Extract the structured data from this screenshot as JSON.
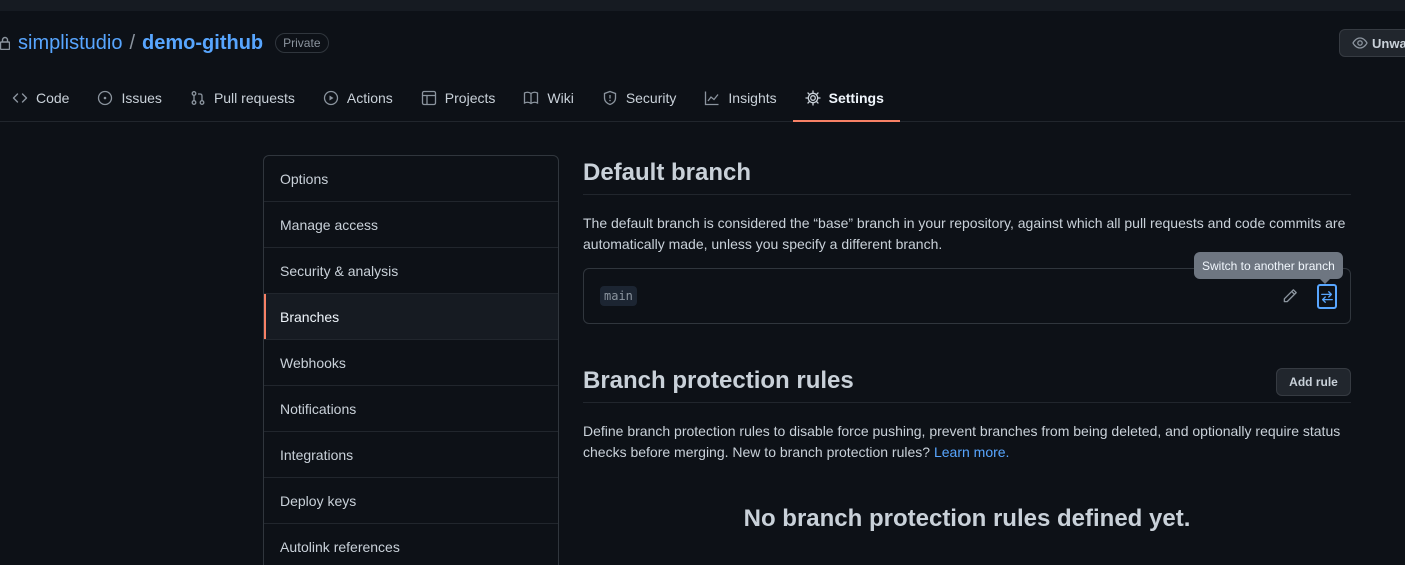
{
  "repo": {
    "owner": "simplistudio",
    "separator": "/",
    "name": "demo-github",
    "visibility": "Private",
    "watch_label": "Unwatch"
  },
  "tabs": [
    {
      "label": "Code",
      "icon": "code-icon"
    },
    {
      "label": "Issues",
      "icon": "issue-icon"
    },
    {
      "label": "Pull requests",
      "icon": "pull-request-icon"
    },
    {
      "label": "Actions",
      "icon": "play-icon"
    },
    {
      "label": "Projects",
      "icon": "table-icon"
    },
    {
      "label": "Wiki",
      "icon": "book-icon"
    },
    {
      "label": "Security",
      "icon": "shield-icon"
    },
    {
      "label": "Insights",
      "icon": "graph-icon"
    },
    {
      "label": "Settings",
      "icon": "gear-icon",
      "active": true
    }
  ],
  "sidebar": {
    "items": [
      {
        "label": "Options"
      },
      {
        "label": "Manage access"
      },
      {
        "label": "Security & analysis"
      },
      {
        "label": "Branches",
        "active": true
      },
      {
        "label": "Webhooks"
      },
      {
        "label": "Notifications"
      },
      {
        "label": "Integrations"
      },
      {
        "label": "Deploy keys"
      },
      {
        "label": "Autolink references"
      }
    ]
  },
  "default_branch": {
    "title": "Default branch",
    "description": "The default branch is considered the “base” branch in your repository, against which all pull requests and code commits are automatically made, unless you specify a different branch.",
    "branch": "main",
    "tooltip": "Switch to another branch"
  },
  "protection": {
    "title": "Branch protection rules",
    "add_button": "Add rule",
    "description": "Define branch protection rules to disable force pushing, prevent branches from being deleted, and optionally require status checks before merging. New to branch protection rules?",
    "learn_more": "Learn more.",
    "empty_text": "No branch protection rules defined yet."
  },
  "colors": {
    "background": "#0d1117",
    "link": "#58a6ff",
    "active_underline": "#f78166",
    "tooltip_bg": "#6e7681"
  }
}
